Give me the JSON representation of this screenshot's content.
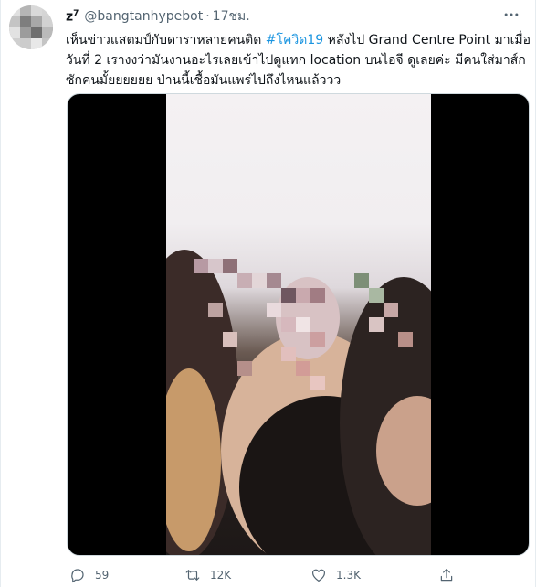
{
  "tweet": {
    "display_name": "z",
    "name_superscript": "7",
    "handle": "@bangtanhypebot",
    "separator": "·",
    "time": "17ชม.",
    "text_line1_a": "เห็นข่าวแสตมป์กับดาราหลายคนติด ",
    "hashtag": "#โควิด19",
    "text_line1_b": " หลังไป Grand Centre Point มาเมื่อ",
    "text_line2": "วันที่ 2 เรางงว่ามันงานอะไรเลยเข้าไปดูแทก location บนไอจี ดูเลยค่ะ มีคนใส่มาส์ก",
    "text_line3": "ซักคนมั้ยยยยยย ป่านนี้เชื้อมันแพร่ไปถึงไหนแล้ววว"
  },
  "actions": {
    "reply_count": "59",
    "retweet_count": "12K",
    "like_count": "1.3K"
  },
  "icons": {
    "more": "more-icon",
    "reply": "reply-icon",
    "retweet": "retweet-icon",
    "like": "heart-icon",
    "share": "share-icon"
  },
  "colors": {
    "link": "#1b95e0",
    "muted": "#536471",
    "text": "#0f1419"
  }
}
